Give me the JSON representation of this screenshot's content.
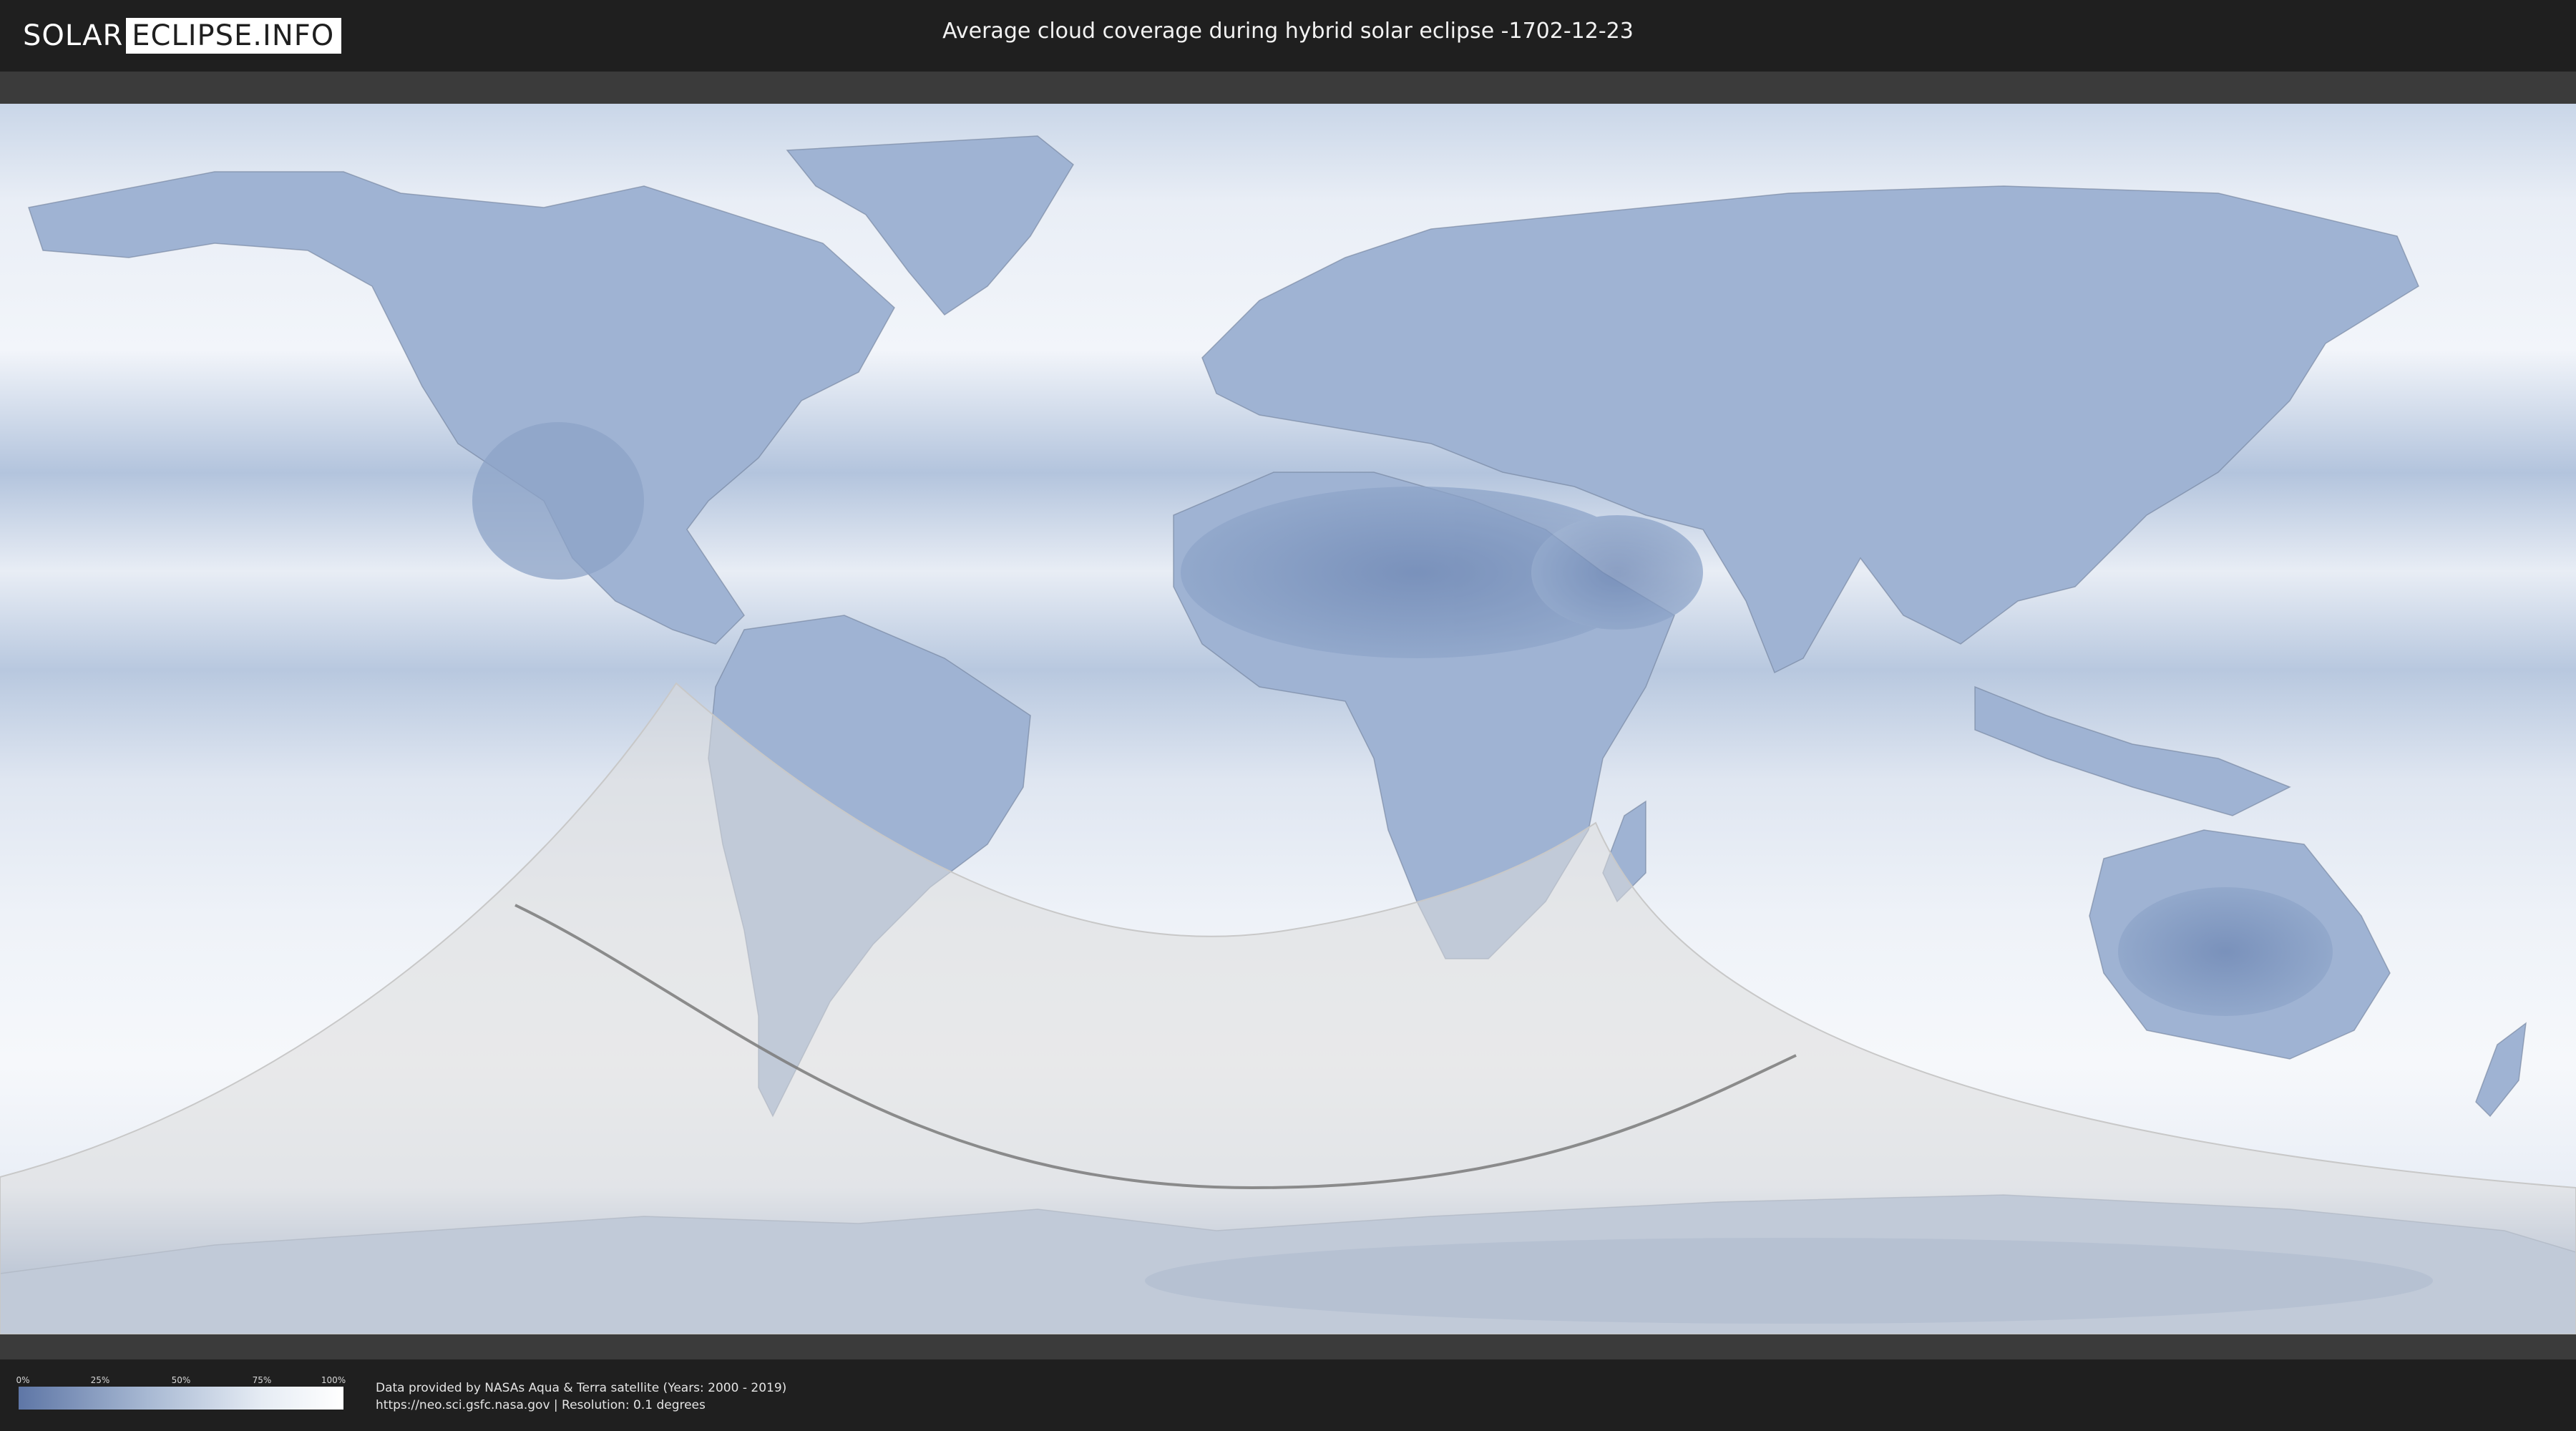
{
  "header": {
    "logo_left": "SOLAR",
    "logo_right": "ECLIPSE.INFO",
    "title": "Average cloud coverage during hybrid solar eclipse -1702-12-23"
  },
  "legend": {
    "ticks": [
      "0%",
      "25%",
      "50%",
      "75%",
      "100%"
    ],
    "colors": {
      "low": "#5e76a6",
      "mid": "#a8b9d3",
      "high": "#ffffff"
    }
  },
  "footer": {
    "credit_line1": "Data provided by NASAs Aqua & Terra satellite (Years: 2000 - 2019)",
    "credit_line2": "https://neo.sci.gsfc.nasa.gov | Resolution: 0.1 degrees"
  },
  "map": {
    "colors": {
      "cloud_clear": "#7f98c2",
      "cloud_full": "#f4f7fb",
      "eclipse_region": "#dcdcdc",
      "central_line": "#7a7a7a"
    }
  }
}
